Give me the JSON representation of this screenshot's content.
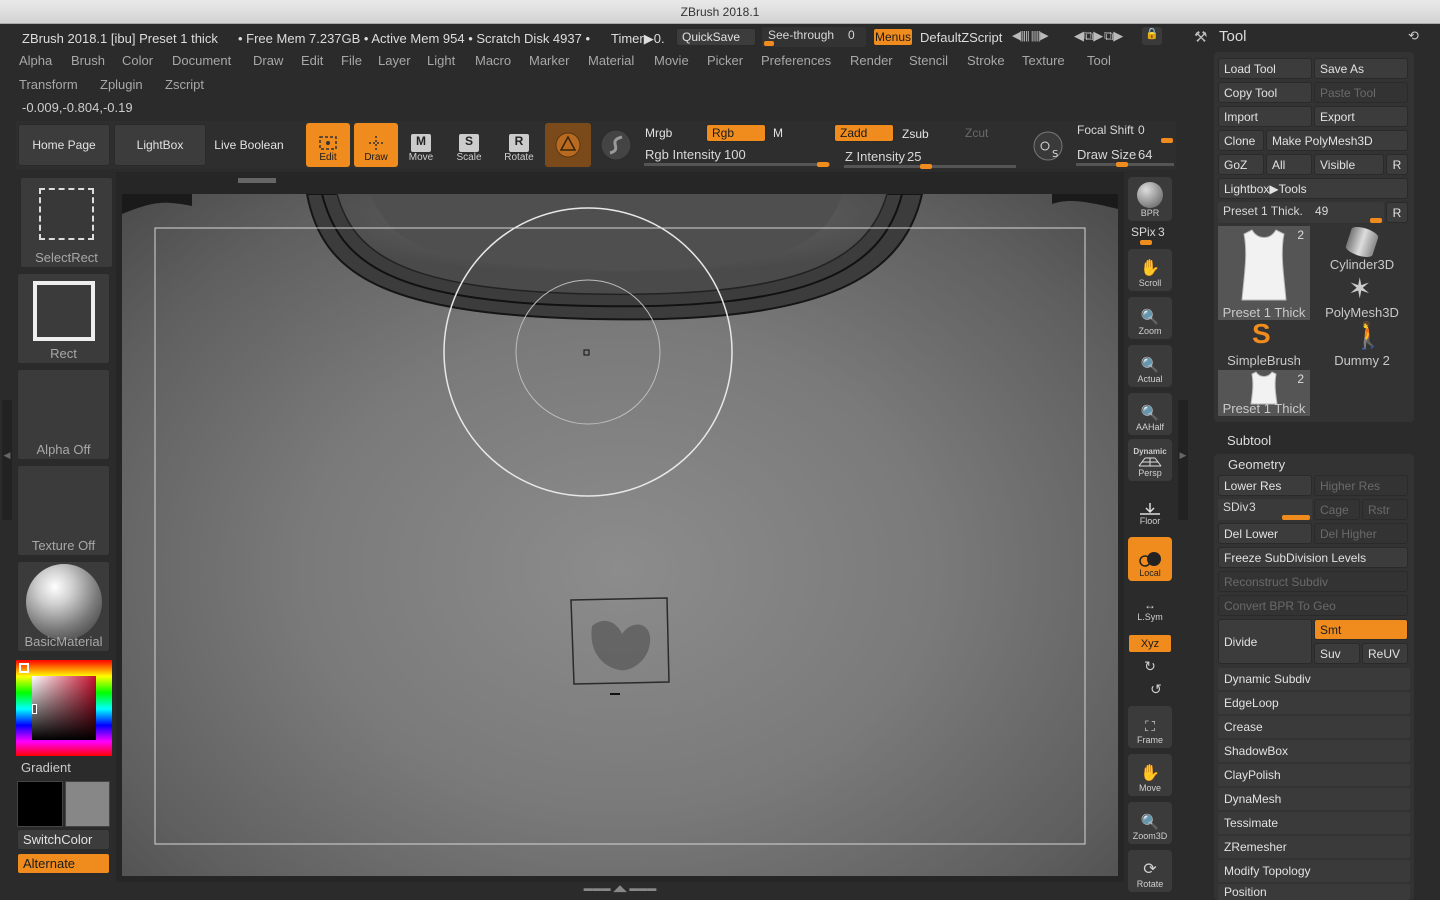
{
  "window": {
    "title": "ZBrush 2018.1"
  },
  "status": {
    "app": "ZBrush 2018.1 [ibu] Preset 1 thick",
    "mem": "• Free Mem 7.237GB • Active Mem 954 • Scratch Disk 4937 •",
    "timer": "Timer▶0.",
    "quicksave": "QuickSave",
    "seethrough": "See-through",
    "seethrough_value": "0",
    "menus": "Menus",
    "zscript": "DefaultZScript"
  },
  "menubar": [
    "Alpha",
    "Brush",
    "Color",
    "Document",
    "Draw",
    "Edit",
    "File",
    "Layer",
    "Light",
    "Macro",
    "Marker",
    "Material",
    "Movie",
    "Picker",
    "Preferences",
    "Render",
    "Stencil",
    "Stroke",
    "Texture",
    "Tool"
  ],
  "menubar2": [
    "Transform",
    "Zplugin",
    "Zscript"
  ],
  "coords": "-0.009,-0.804,-0.19",
  "toolbar": {
    "home": "Home Page",
    "lightbox": "LightBox",
    "liveboolean": "Live Boolean",
    "edit": "Edit",
    "draw": "Draw",
    "move": "Move",
    "scale": "Scale",
    "rotate": "Rotate",
    "mrgb": "Mrgb",
    "rgb": "Rgb",
    "m": "M",
    "zadd": "Zadd",
    "zsub": "Zsub",
    "zcut": "Zcut",
    "rgb_intensity_label": "Rgb Intensity",
    "rgb_intensity": "100",
    "z_intensity_label": "Z Intensity",
    "z_intensity": "25",
    "focal_label": "Focal Shift",
    "focal": "0",
    "drawsize_label": "Draw Size",
    "drawsize": "64"
  },
  "left": {
    "selectrect": "SelectRect",
    "rect": "Rect",
    "alpha": "Alpha Off",
    "texture": "Texture Off",
    "material": "BasicMaterial",
    "gradient": "Gradient",
    "switchcolor": "SwitchColor",
    "alternate": "Alternate"
  },
  "shelf": {
    "bpr": "BPR",
    "spix_label": "SPix",
    "spix": "3",
    "scroll": "Scroll",
    "zoom": "Zoom",
    "actual": "Actual",
    "aahalf": "AAHalf",
    "dynamic": "Dynamic",
    "persp": "Persp",
    "floor": "Floor",
    "local": "Local",
    "lsym": "L.Sym",
    "xyz": "Xyz",
    "frame": "Frame",
    "move": "Move",
    "zoom3d": "Zoom3D",
    "rotate": "Rotate"
  },
  "tool": {
    "title": "Tool",
    "load": "Load Tool",
    "saveas": "Save As",
    "copy": "Copy Tool",
    "paste": "Paste Tool",
    "import": "Import",
    "export": "Export",
    "clone": "Clone",
    "polymesh": "Make PolyMesh3D",
    "goz": "GoZ",
    "all": "All",
    "visible": "Visible",
    "r": "R",
    "lightbox": "Lightbox▶Tools",
    "preset_label": "Preset 1 Thick.",
    "preset_value": "49",
    "thumbs": [
      {
        "label": "Preset 1 Thick",
        "count": "2"
      },
      {
        "label": "Cylinder3D",
        "count": ""
      },
      {
        "label": "PolyMesh3D",
        "count": ""
      },
      {
        "label": "SimpleBrush",
        "count": ""
      },
      {
        "label": "Dummy 2",
        "count": ""
      },
      {
        "label": "Preset 1 Thick",
        "count": "2"
      }
    ],
    "subtool": "Subtool",
    "geometry": "Geometry",
    "lowerres": "Lower Res",
    "higherres": "Higher Res",
    "sdiv_label": "SDiv",
    "sdiv": "3",
    "cage": "Cage",
    "rstr": "Rstr",
    "dellower": "Del Lower",
    "delhigher": "Del Higher",
    "freeze": "Freeze SubDivision Levels",
    "reconstruct": "Reconstruct Subdiv",
    "convertbpr": "Convert BPR To Geo",
    "divide": "Divide",
    "smt": "Smt",
    "suv": "Suv",
    "reuv": "ReUV",
    "sections": [
      "Dynamic Subdiv",
      "EdgeLoop",
      "Crease",
      "ShadowBox",
      "ClayPolish",
      "DynaMesh",
      "Tessimate",
      "ZRemesher",
      "Modify Topology",
      "Position"
    ]
  }
}
